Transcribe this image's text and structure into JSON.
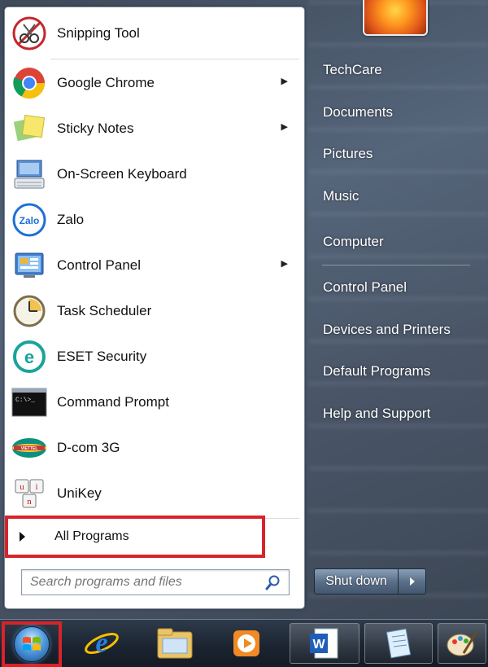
{
  "start_menu": {
    "pinned": [
      {
        "label": "Snipping Tool",
        "icon": "scissors-icon",
        "has_submenu": false
      },
      {
        "label": "Google Chrome",
        "icon": "chrome-icon",
        "has_submenu": true
      },
      {
        "label": "Sticky Notes",
        "icon": "sticky-notes-icon",
        "has_submenu": true
      },
      {
        "label": "On-Screen Keyboard",
        "icon": "keyboard-icon",
        "has_submenu": false
      },
      {
        "label": "Zalo",
        "icon": "zalo-icon",
        "has_submenu": false
      },
      {
        "label": "Control Panel",
        "icon": "control-panel-icon",
        "has_submenu": true
      },
      {
        "label": "Task Scheduler",
        "icon": "clock-icon",
        "has_submenu": false
      },
      {
        "label": "ESET Security",
        "icon": "eset-icon",
        "has_submenu": false
      },
      {
        "label": "Command Prompt",
        "icon": "cmd-icon",
        "has_submenu": false
      },
      {
        "label": "D-com 3G",
        "icon": "viettel-icon",
        "has_submenu": false
      },
      {
        "label": "UniKey",
        "icon": "unikey-icon",
        "has_submenu": false
      }
    ],
    "all_programs_label": "All Programs",
    "search_placeholder": "Search programs and files",
    "right_links": [
      "TechCare",
      "Documents",
      "Pictures",
      "Music",
      "Computer",
      "Control Panel",
      "Devices and Printers",
      "Default Programs",
      "Help and Support"
    ],
    "shutdown_label": "Shut down"
  },
  "taskbar": {
    "icons": [
      "windows-orb-icon",
      "internet-explorer-icon",
      "file-explorer-icon",
      "media-player-icon",
      "word-icon",
      "notepad-icon",
      "paint-icon"
    ]
  },
  "colors": {
    "highlight_red": "#d8232a",
    "accent_blue": "#4f9be0"
  }
}
